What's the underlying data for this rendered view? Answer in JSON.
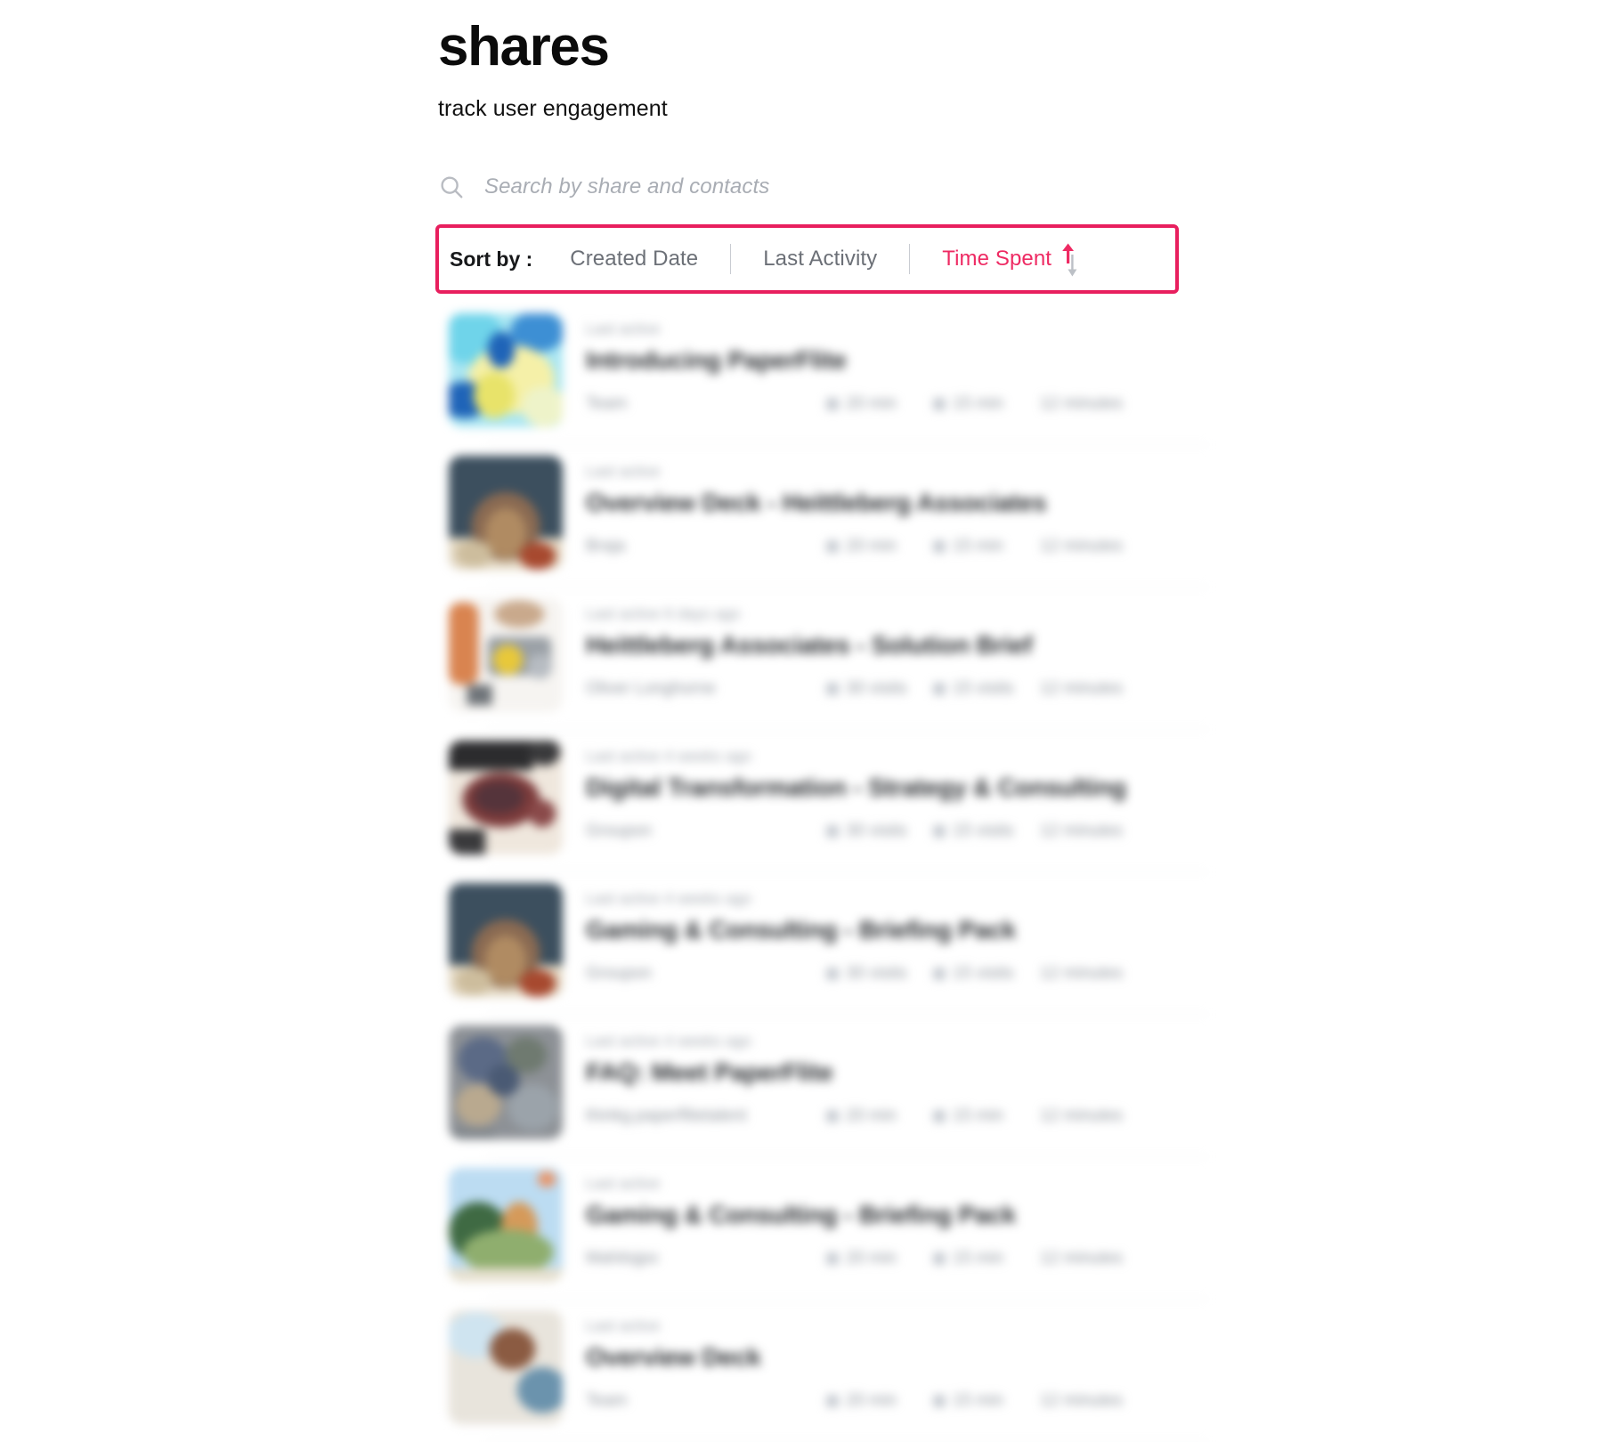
{
  "app": {
    "title": "shares",
    "subtitle": "track user engagement"
  },
  "search": {
    "icon": "search-icon",
    "placeholder": "Search by share and contacts",
    "value": ""
  },
  "sort_bar": {
    "label": "Sort by :",
    "highlight_color": "#e81f5e",
    "active_color": "#ee2a63",
    "inactive_color": "#6c7077",
    "separator": "|",
    "options": [
      {
        "label": "Created Date",
        "active": false
      },
      {
        "label": "Last Activity",
        "active": false
      },
      {
        "label": "Time Spent",
        "active": true
      }
    ],
    "active_option": "Time Spent",
    "sort_direction_icon": "sort-arrows-icon",
    "sort_direction": "ascending"
  },
  "list": {
    "redacted": true,
    "rows": [
      {
        "meta": "Last active",
        "title": "Introducing PaperFlite",
        "owner": "Team",
        "stat_1": "20 min",
        "stat_2": "15 min",
        "stat_3": "12 minutes",
        "thumb": {
          "name": "thumb-abstract-blue-yellow",
          "colors": [
            "#9fe7f5",
            "#3d8fd4",
            "#f5f0a8",
            "#1f64b8"
          ]
        }
      },
      {
        "meta": "Last active",
        "title": "Overview Deck - Heittleberg Associates",
        "owner": "Braja",
        "stat_1": "20 min",
        "stat_2": "15 min",
        "stat_3": "12 minutes",
        "thumb": {
          "name": "thumb-dark-interior",
          "colors": [
            "#3c4f5e",
            "#8a6a52",
            "#e4d9c4",
            "#a7492f"
          ]
        }
      },
      {
        "meta": "Last active 6 days ago",
        "title": "Heittleberg Associates - Solution Brief",
        "owner": "Oliver Longhorne",
        "stat_1": "30 visits",
        "stat_2": "15 visits",
        "stat_3": "12 minutes",
        "thumb": {
          "name": "thumb-orange-workspace",
          "colors": [
            "#d98450",
            "#f6f4f1",
            "#e8c83a",
            "#9aa0a6"
          ]
        }
      },
      {
        "meta": "Last active 4 weeks ago",
        "title": "Digital Transformation - Strategy & Consulting",
        "owner": "Groupon",
        "stat_1": "30 visits",
        "stat_2": "15 visits",
        "stat_3": "12 minutes",
        "thumb": {
          "name": "thumb-dark-maroon-desk",
          "colors": [
            "#2c2c2e",
            "#7c3b3b",
            "#efe7dd",
            "#55343b"
          ]
        }
      },
      {
        "meta": "Last active 4 weeks ago",
        "title": "Gaming & Consulting - Briefing Pack",
        "owner": "Groupon",
        "stat_1": "30 visits",
        "stat_2": "15 visits",
        "stat_3": "12 minutes",
        "thumb": {
          "name": "thumb-dark-interior-2",
          "colors": [
            "#3c4f5e",
            "#8a6a52",
            "#e4d9c4",
            "#a7492f"
          ]
        }
      },
      {
        "meta": "Last active 4 weeks ago",
        "title": "FAQ: Meet PaperFlite",
        "owner": "thinkg.paperflitetalent",
        "stat_1": "20 min",
        "stat_2": "15 min",
        "stat_3": "12 minutes",
        "thumb": {
          "name": "thumb-grey-collage",
          "colors": [
            "#8d9196",
            "#5b6a86",
            "#b9a98f",
            "#6f7a70"
          ]
        }
      },
      {
        "meta": "Last active",
        "title": "Gaming & Consulting - Briefing Pack",
        "owner": "Mahitsjpo",
        "stat_1": "20 min",
        "stat_2": "15 min",
        "stat_3": "12 minutes",
        "thumb": {
          "name": "thumb-landscape-hills",
          "colors": [
            "#bcdcf2",
            "#3f6a43",
            "#d59a5a",
            "#8fae6e"
          ]
        }
      },
      {
        "meta": "Last active",
        "title": "Overview Deck",
        "owner": "Team",
        "stat_1": "20 min",
        "stat_2": "15 min",
        "stat_3": "12 minutes",
        "thumb": {
          "name": "thumb-light-blue-brown",
          "colors": [
            "#cfe4f0",
            "#8b5b42",
            "#e8e4dc",
            "#6b93ad"
          ]
        }
      }
    ]
  }
}
